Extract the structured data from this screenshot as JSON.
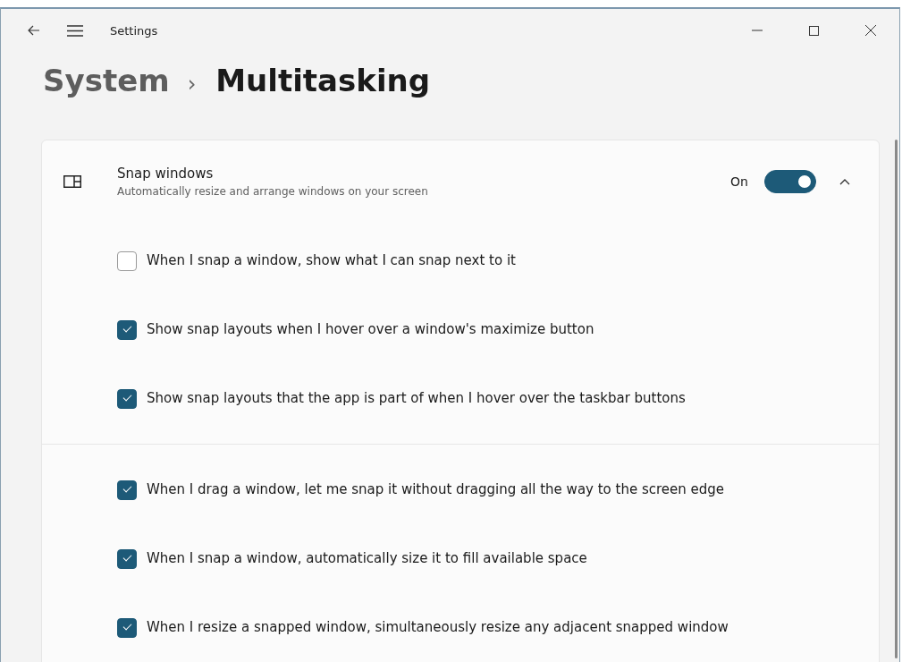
{
  "window": {
    "title": "Settings"
  },
  "breadcrumb": {
    "parent": "System",
    "separator": "›",
    "current": "Multitasking"
  },
  "setting": {
    "title": "Snap windows",
    "description": "Automatically resize and arrange windows on your screen",
    "state_label": "On",
    "on": true,
    "expanded": true
  },
  "option_groups": [
    [
      {
        "label": "When I snap a window, show what I can snap next to it",
        "checked": false
      },
      {
        "label": "Show snap layouts when I hover over a window's maximize button",
        "checked": true
      },
      {
        "label": "Show snap layouts that the app is part of when I hover over the taskbar buttons",
        "checked": true
      }
    ],
    [
      {
        "label": "When I drag a window, let me snap it without dragging all the way to the screen edge",
        "checked": true
      },
      {
        "label": "When I snap a window, automatically size it to fill available space",
        "checked": true
      },
      {
        "label": "When I resize a snapped window, simultaneously resize any adjacent snapped window",
        "checked": true
      }
    ]
  ]
}
